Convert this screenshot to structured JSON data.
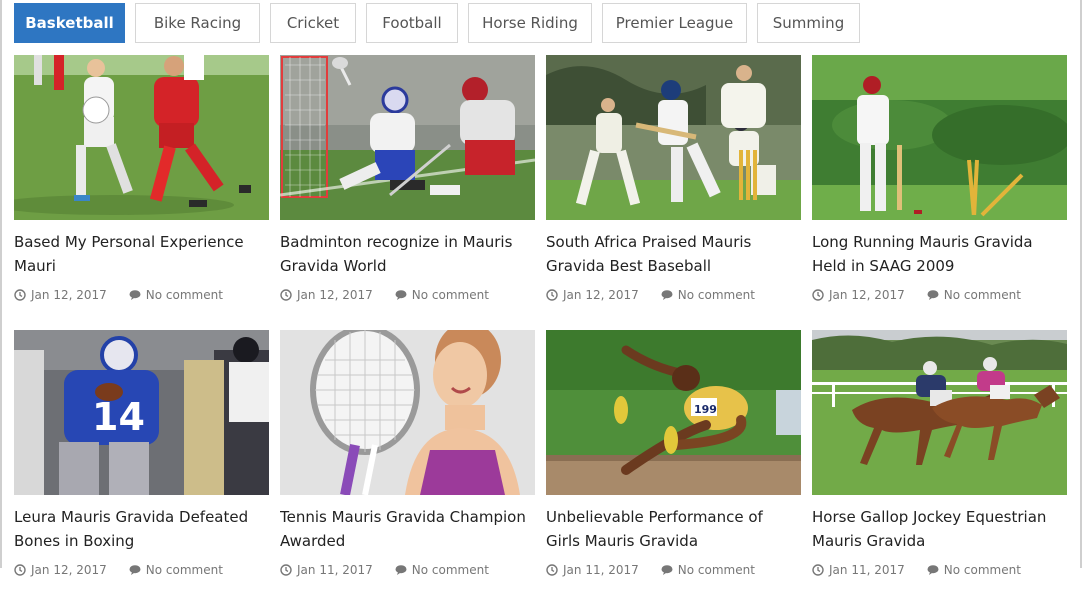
{
  "tabs": [
    {
      "label": "Basketball",
      "active": true
    },
    {
      "label": "Bike Racing",
      "active": false
    },
    {
      "label": "Cricket",
      "active": false
    },
    {
      "label": "Football",
      "active": false
    },
    {
      "label": "Horse Riding",
      "active": false
    },
    {
      "label": "Premier League",
      "active": false
    },
    {
      "label": "Summing",
      "active": false
    }
  ],
  "posts": [
    {
      "title": "Based My Personal Experience Mauri",
      "date": "Jan 12, 2017",
      "comments": "No comment",
      "image": "soccer-players-photo"
    },
    {
      "title": "Badminton recognize in Mauris Gravida World",
      "date": "Jan 12, 2017",
      "comments": "No comment",
      "image": "lacrosse-players-photo"
    },
    {
      "title": "South Africa Praised Mauris Gravida Best Baseball",
      "date": "Jan 12, 2017",
      "comments": "No comment",
      "image": "cricket-match-photo"
    },
    {
      "title": "Long Running Mauris Gravida Held in SAAG 2009",
      "date": "Jan 12, 2017",
      "comments": "No comment",
      "image": "cricket-batsman-bowled-photo"
    },
    {
      "title": "Leura Mauris Gravida Defeated Bones in Boxing",
      "date": "Jan 12, 2017",
      "comments": "No comment",
      "image": "american-football-photo"
    },
    {
      "title": "Tennis Mauris Gravida Champion Awarded",
      "date": "Jan 11, 2017",
      "comments": "No comment",
      "image": "tennis-player-photo"
    },
    {
      "title": "Unbelievable Performance of Girls Mauris Gravida",
      "date": "Jan 11, 2017",
      "comments": "No comment",
      "image": "long-jump-athlete-photo"
    },
    {
      "title": "Horse Gallop Jockey Equestrian Mauris Gravida",
      "date": "Jan 11, 2017",
      "comments": "No comment",
      "image": "horse-racing-photo"
    }
  ],
  "colors": {
    "accent": "#2e76c2",
    "text": "#222222",
    "meta": "#777777",
    "border": "#d6d6d6"
  },
  "icons": {
    "date": "clock-icon",
    "comments": "comment-icon"
  }
}
